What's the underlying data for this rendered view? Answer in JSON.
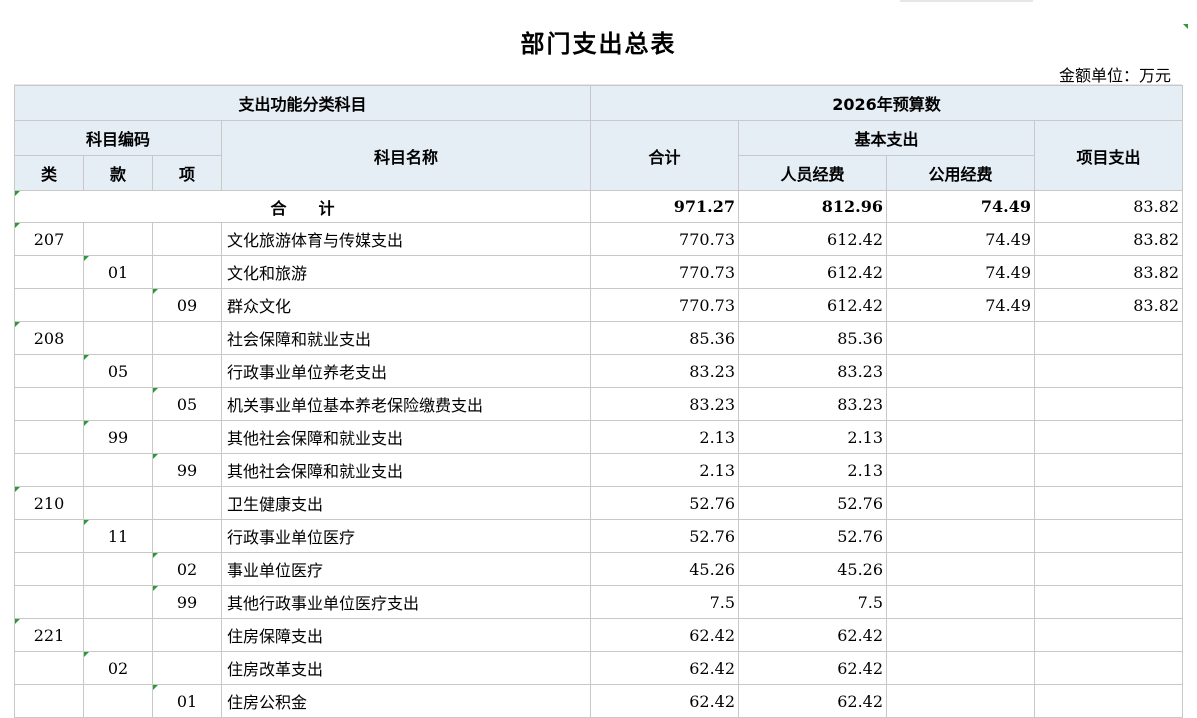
{
  "title": "部门支出总表",
  "unit": "金额单位：万元",
  "header": {
    "category_group": "支出功能分类科目",
    "budget_group": "2026年预算数",
    "code_group": "科目编码",
    "col_lei": "类",
    "col_kuan": "款",
    "col_xiang": "项",
    "col_name": "科目名称",
    "col_total": "合计",
    "basic_group": "基本支出",
    "col_personnel": "人员经费",
    "col_public": "公用经费",
    "col_project": "项目支出"
  },
  "total_row": {
    "label": "合　　计",
    "total": "971.27",
    "personnel": "812.96",
    "public": "74.49",
    "project": "83.82"
  },
  "rows": [
    {
      "lei": "207",
      "kuan": "",
      "xiang": "",
      "name": "文化旅游体育与传媒支出",
      "total": "770.73",
      "personnel": "612.42",
      "public": "74.49",
      "project": "83.82"
    },
    {
      "lei": "",
      "kuan": "01",
      "xiang": "",
      "name": "文化和旅游",
      "total": "770.73",
      "personnel": "612.42",
      "public": "74.49",
      "project": "83.82"
    },
    {
      "lei": "",
      "kuan": "",
      "xiang": "09",
      "name": "群众文化",
      "total": "770.73",
      "personnel": "612.42",
      "public": "74.49",
      "project": "83.82"
    },
    {
      "lei": "208",
      "kuan": "",
      "xiang": "",
      "name": "社会保障和就业支出",
      "total": "85.36",
      "personnel": "85.36",
      "public": "",
      "project": ""
    },
    {
      "lei": "",
      "kuan": "05",
      "xiang": "",
      "name": "行政事业单位养老支出",
      "total": "83.23",
      "personnel": "83.23",
      "public": "",
      "project": ""
    },
    {
      "lei": "",
      "kuan": "",
      "xiang": "05",
      "name": "机关事业单位基本养老保险缴费支出",
      "total": "83.23",
      "personnel": "83.23",
      "public": "",
      "project": ""
    },
    {
      "lei": "",
      "kuan": "99",
      "xiang": "",
      "name": "其他社会保障和就业支出",
      "total": "2.13",
      "personnel": "2.13",
      "public": "",
      "project": ""
    },
    {
      "lei": "",
      "kuan": "",
      "xiang": "99",
      "name": "其他社会保障和就业支出",
      "total": "2.13",
      "personnel": "2.13",
      "public": "",
      "project": ""
    },
    {
      "lei": "210",
      "kuan": "",
      "xiang": "",
      "name": "卫生健康支出",
      "total": "52.76",
      "personnel": "52.76",
      "public": "",
      "project": ""
    },
    {
      "lei": "",
      "kuan": "11",
      "xiang": "",
      "name": "行政事业单位医疗",
      "total": "52.76",
      "personnel": "52.76",
      "public": "",
      "project": ""
    },
    {
      "lei": "",
      "kuan": "",
      "xiang": "02",
      "name": "事业单位医疗",
      "total": "45.26",
      "personnel": "45.26",
      "public": "",
      "project": ""
    },
    {
      "lei": "",
      "kuan": "",
      "xiang": "99",
      "name": "其他行政事业单位医疗支出",
      "total": "7.5",
      "personnel": "7.5",
      "public": "",
      "project": ""
    },
    {
      "lei": "221",
      "kuan": "",
      "xiang": "",
      "name": "住房保障支出",
      "total": "62.42",
      "personnel": "62.42",
      "public": "",
      "project": ""
    },
    {
      "lei": "",
      "kuan": "02",
      "xiang": "",
      "name": "住房改革支出",
      "total": "62.42",
      "personnel": "62.42",
      "public": "",
      "project": ""
    },
    {
      "lei": "",
      "kuan": "",
      "xiang": "01",
      "name": "住房公积金",
      "total": "62.42",
      "personnel": "62.42",
      "public": "",
      "project": ""
    }
  ]
}
